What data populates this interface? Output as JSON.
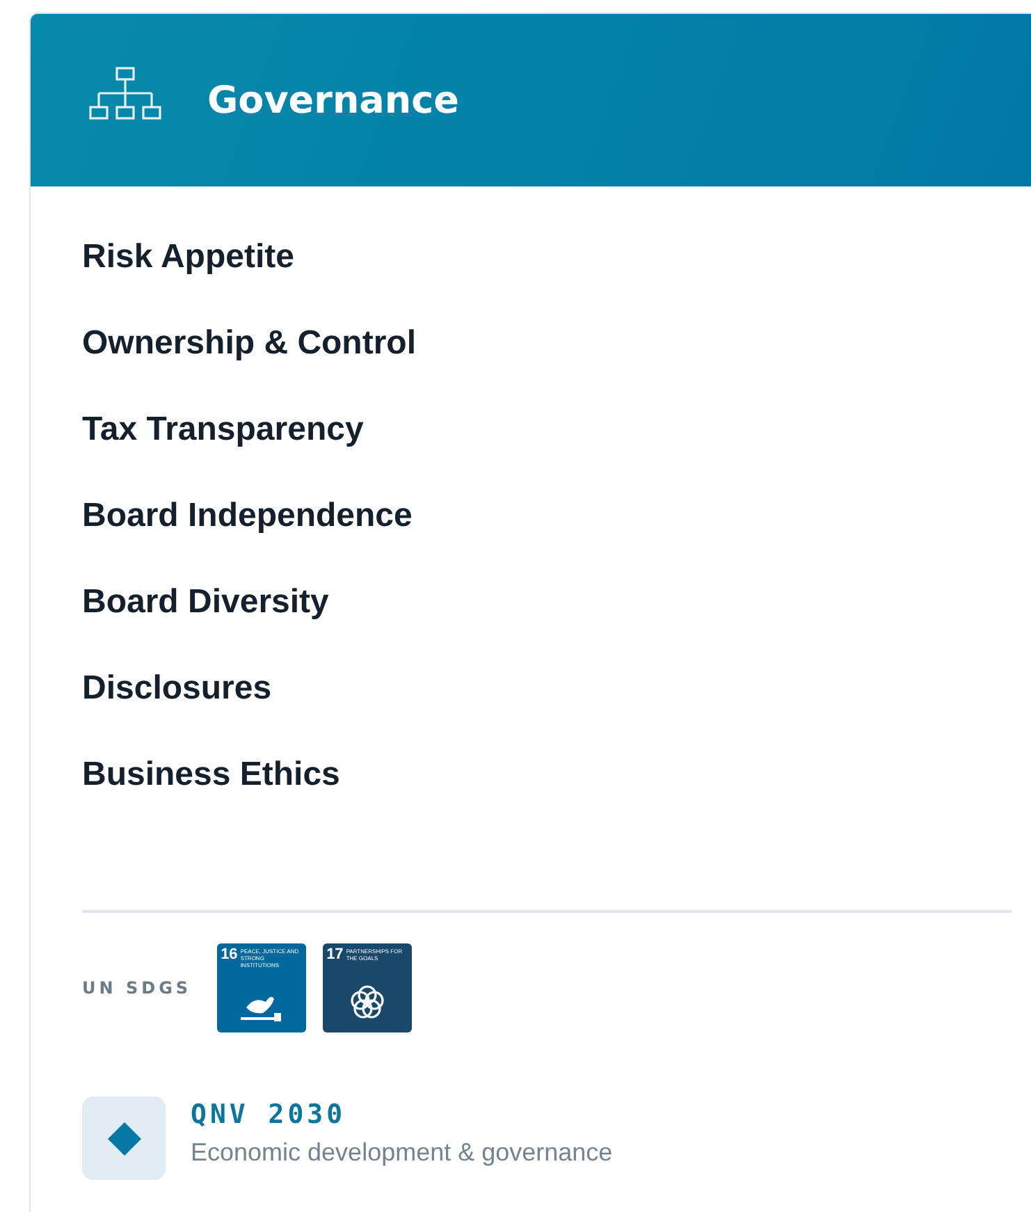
{
  "header": {
    "title": "Governance"
  },
  "topics": [
    "Risk Appetite",
    "Ownership & Control",
    "Tax Transparency",
    "Board Independence",
    "Board Diversity",
    "Disclosures",
    "Business Ethics"
  ],
  "sdgs": {
    "label": "UN SDGS",
    "goals": [
      {
        "number": "16",
        "title": "PEACE, JUSTICE AND STRONG INSTITUTIONS",
        "color": "#00689d",
        "kind": "dove"
      },
      {
        "number": "17",
        "title": "PARTNERSHIPS FOR THE GOALS",
        "color": "#19486a",
        "kind": "rings"
      }
    ]
  },
  "vision": {
    "title": "QNV 2030",
    "subtitle": "Economic development & governance"
  }
}
